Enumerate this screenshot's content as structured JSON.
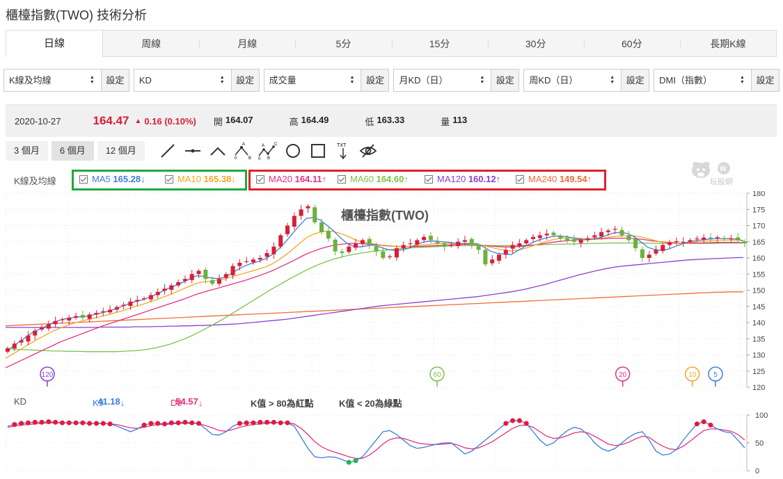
{
  "page": {
    "title": "櫃檯指數(TWO) 技術分析"
  },
  "tabs": [
    {
      "label": "日線",
      "active": true
    },
    {
      "label": "周線"
    },
    {
      "label": "月線"
    },
    {
      "label": "5分"
    },
    {
      "label": "15分"
    },
    {
      "label": "30分"
    },
    {
      "label": "60分"
    },
    {
      "label": "長期K線"
    }
  ],
  "selectors": [
    {
      "value": "K線及均線",
      "button": "設定"
    },
    {
      "value": "KD",
      "button": "設定"
    },
    {
      "value": "成交量",
      "button": "設定"
    },
    {
      "value": "月KD（日）",
      "button": "設定"
    },
    {
      "value": "周KD（日）",
      "button": "設定"
    },
    {
      "value": "DMI（指數）",
      "button": "設定"
    }
  ],
  "quote": {
    "date": "2020-10-27",
    "price": "164.47",
    "change": "0.16 (0.10%)",
    "open_label": "開",
    "open": "164.07",
    "high_label": "高",
    "high": "164.49",
    "low_label": "低",
    "low": "163.33",
    "volume_label": "量",
    "volume": "113",
    "up_color": "#d81e36"
  },
  "ranges": [
    {
      "label": "3 個月"
    },
    {
      "label": "6 個月",
      "active": true
    },
    {
      "label": "12 個月"
    }
  ],
  "drawing_tools": [
    "line-tool-icon",
    "horizontal-line-icon",
    "angle-line-icon",
    "abc-pattern-icon",
    "abcd-pattern-icon",
    "circle-tool-icon",
    "rectangle-tool-icon",
    "text-tool-icon",
    "hide-drawings-icon"
  ],
  "ma_legend": {
    "label": "K線及均線",
    "items": [
      {
        "name": "MA5",
        "value": "165.28",
        "dir": "↓",
        "color": "#3b7ddd"
      },
      {
        "name": "MA10",
        "value": "165.38",
        "dir": "↓",
        "color": "#f5a623"
      },
      {
        "name": "MA20",
        "value": "164.11",
        "dir": "↑",
        "color": "#e4317e"
      },
      {
        "name": "MA60",
        "value": "164.60",
        "dir": "↑",
        "color": "#7cc04b"
      },
      {
        "name": "MA120",
        "value": "160.12",
        "dir": "↑",
        "color": "#8a3fd1"
      },
      {
        "name": "MA240",
        "value": "149.54",
        "dir": "↑",
        "color": "#f06b3a"
      }
    ],
    "highlight_colors": {
      "green_box": "#1fa93d",
      "red_box": "#e0202a"
    }
  },
  "logo": {
    "text": "玩股網"
  },
  "chart_data": {
    "type": "candlestick",
    "title": "櫃檯指數(TWO)",
    "ylim": [
      120,
      180
    ],
    "yticks": [
      120,
      125,
      130,
      135,
      140,
      145,
      150,
      155,
      160,
      165,
      170,
      175,
      180
    ],
    "up_color": "#d81e36",
    "down_color": "#6cb13b",
    "closes": [
      132,
      133.5,
      134.5,
      136,
      137.5,
      138.5,
      139.5,
      140.5,
      141,
      141.5,
      142,
      141.5,
      142.5,
      143,
      143.5,
      144,
      144.8,
      145.5,
      146.5,
      147,
      147.5,
      148.5,
      149.5,
      150.5,
      151.5,
      152.5,
      153.5,
      155,
      156,
      153.5,
      152,
      153.5,
      155,
      157.5,
      158.5,
      159,
      159.5,
      160,
      161.5,
      163.5,
      167,
      170,
      173,
      175,
      176,
      171,
      168,
      166,
      162,
      161.5,
      163.5,
      164.5,
      165.5,
      164,
      162,
      160,
      160.5,
      163,
      164,
      164.5,
      165.5,
      166.5,
      165.5,
      164.5,
      163.5,
      164,
      165,
      165.5,
      164,
      162.5,
      158,
      159.5,
      161,
      162.5,
      164,
      164.5,
      165.5,
      166.5,
      167,
      167.5,
      167,
      166,
      165.5,
      165,
      165.5,
      166,
      167,
      168,
      168.5,
      169,
      167,
      165.5,
      163,
      160,
      161,
      162.5,
      164,
      164.8,
      165.2,
      165,
      165.5,
      166,
      166.3,
      166,
      166.4,
      165.8,
      166,
      165.5,
      164.5
    ],
    "ma_series": [
      {
        "name": "MA5",
        "values": [
          131,
          132.5,
          134,
          135.5,
          137,
          138,
          139,
          140,
          140.8,
          141.3,
          141.6,
          141.8,
          142,
          142.5,
          143,
          143.5,
          144.2,
          145,
          145.8,
          146.5,
          147,
          147.8,
          148.7,
          149.7,
          150.7,
          151.6,
          152.5,
          153.6,
          154.5,
          154.3,
          153.8,
          153.6,
          154,
          155.1,
          156.4,
          157.5,
          158.3,
          158.9,
          159.7,
          161,
          162.8,
          165,
          167.5,
          170,
          172.2,
          172.5,
          171.8,
          170.2,
          168.4,
          166.3,
          164.5,
          163.5,
          163.4,
          163.8,
          164,
          163.2,
          162.6,
          162.3,
          162.5,
          163,
          164,
          164.8,
          165.2,
          165.2,
          165,
          164.8,
          164.5,
          164.5,
          164.5,
          164.4,
          163.4,
          162.1,
          161.4,
          161.2,
          161,
          162.3,
          163.5,
          164.6,
          165.5,
          166.1,
          166.6,
          166.8,
          166.6,
          166.2,
          165.8,
          165.6,
          165.8,
          166.3,
          167,
          167.7,
          167.9,
          167.6,
          166.6,
          165,
          163.3,
          162.6,
          162.3,
          162.7,
          163.5,
          164.3,
          165,
          165.3,
          165.6,
          165.8,
          166,
          166,
          166,
          165.8,
          165.3
        ]
      },
      {
        "name": "MA10",
        "values": [
          129,
          130.2,
          131.4,
          132.8,
          134,
          135.2,
          136.3,
          137.4,
          138.3,
          139.1,
          139.8,
          140.4,
          140.9,
          141.4,
          141.9,
          142.4,
          143,
          143.6,
          144.3,
          145,
          145.6,
          146.3,
          147,
          147.8,
          148.6,
          149.5,
          150.4,
          151.3,
          152.2,
          152.6,
          152.8,
          153.1,
          153.5,
          154.1,
          154.7,
          155.3,
          155.9,
          156.5,
          157.2,
          158.1,
          159.4,
          160.9,
          162.6,
          164.4,
          166.2,
          167.3,
          168,
          168.3,
          168.2,
          167.6,
          166.8,
          165.8,
          165,
          164.6,
          164.3,
          164,
          163.8,
          163.6,
          163.5,
          163.6,
          163.8,
          164,
          164.2,
          164.4,
          164.5,
          164.5,
          164.5,
          164.5,
          164.4,
          164.2,
          163.8,
          163.3,
          162.8,
          162.4,
          162.2,
          162.4,
          162.9,
          163.6,
          164.3,
          165,
          165.6,
          166,
          166.2,
          166.2,
          166.1,
          166,
          166,
          166.1,
          166.3,
          166.6,
          166.8,
          166.9,
          166.8,
          166.5,
          166,
          165.4,
          164.9,
          164.6,
          164.5,
          164.6,
          164.8,
          164.9,
          165.1,
          165.3,
          165.4,
          165.5,
          165.5,
          165.5,
          165.4
        ]
      },
      {
        "name": "MA20",
        "values": [
          126,
          127,
          128,
          129,
          130,
          131,
          132,
          133,
          134,
          134.8,
          135.6,
          136.4,
          137.2,
          138,
          138.8,
          139.5,
          140.2,
          140.9,
          141.6,
          142.3,
          143,
          143.7,
          144.4,
          145.1,
          145.8,
          146.5,
          147.2,
          148,
          148.8,
          149.4,
          150,
          150.6,
          151.2,
          151.8,
          152.4,
          153,
          153.7,
          154.4,
          155.2,
          156,
          157,
          158,
          159,
          160.1,
          161.2,
          162,
          162.8,
          163.4,
          163.9,
          164.2,
          164.4,
          164.5,
          164.4,
          164.3,
          164.1,
          163.9,
          163.7,
          163.6,
          163.5,
          163.5,
          163.5,
          163.6,
          163.7,
          163.8,
          163.9,
          164,
          164.1,
          164.2,
          164.2,
          164.1,
          163.9,
          163.7,
          163.5,
          163.4,
          163.4,
          163.5,
          163.7,
          163.9,
          164.2,
          164.5,
          164.8,
          165.1,
          165.3,
          165.5,
          165.6,
          165.7,
          165.8,
          165.9,
          166,
          166.1,
          166.1,
          166.1,
          166,
          165.8,
          165.5,
          165.2,
          165,
          164.8,
          164.7,
          164.6,
          164.6,
          164.6,
          164.6,
          164.7,
          164.8,
          164.8,
          164.8,
          164.8,
          164.7
        ]
      },
      {
        "name": "MA60",
        "values": [
          132,
          131.8,
          131.7,
          131.6,
          131.5,
          131.4,
          131.3,
          131.2,
          131.2,
          131.1,
          131.1,
          131.1,
          131,
          131,
          131,
          131,
          131,
          131.1,
          131.2,
          131.3,
          131.5,
          131.8,
          132.2,
          132.7,
          133.3,
          134,
          134.8,
          135.7,
          136.7,
          137.8,
          138.9,
          140.1,
          141.3,
          142.6,
          143.9,
          145.2,
          146.5,
          147.8,
          149.1,
          150.4,
          151.6,
          152.8,
          154,
          155.1,
          156.2,
          157.2,
          158.1,
          158.9,
          159.6,
          160.2,
          160.7,
          161.1,
          161.5,
          161.8,
          162.1,
          162.3,
          162.5,
          162.7,
          162.9,
          163.1,
          163.2,
          163.3,
          163.4,
          163.5,
          163.6,
          163.7,
          163.8,
          163.8,
          163.8,
          163.8,
          163.8,
          163.8,
          163.8,
          163.8,
          163.8,
          163.9,
          163.9,
          164,
          164,
          164.1,
          164.2,
          164.2,
          164.3,
          164.3,
          164.4,
          164.4,
          164.5,
          164.5,
          164.6,
          164.6,
          164.6,
          164.6,
          164.6,
          164.6,
          164.6,
          164.5,
          164.5,
          164.5,
          164.5,
          164.5,
          164.5,
          164.5,
          164.5,
          164.5,
          164.5,
          164.6,
          164.6,
          164.6,
          164.6
        ]
      },
      {
        "name": "MA120",
        "values": [
          138.5,
          138.5,
          138.5,
          138.5,
          138.5,
          138.5,
          138.5,
          138.5,
          138.5,
          138.5,
          138.5,
          138.5,
          138.5,
          138.5,
          138.6,
          138.6,
          138.6,
          138.6,
          138.6,
          138.7,
          138.7,
          138.7,
          138.8,
          138.8,
          138.9,
          138.9,
          139,
          139,
          139.1,
          139.1,
          139.2,
          139.3,
          139.4,
          139.5,
          139.6,
          139.8,
          140,
          140.2,
          140.4,
          140.6,
          140.8,
          141,
          141.3,
          141.6,
          141.9,
          142.2,
          142.5,
          142.8,
          143.1,
          143.4,
          143.7,
          144,
          144.3,
          144.6,
          144.9,
          145.2,
          145.4,
          145.6,
          145.8,
          146,
          146.2,
          146.4,
          146.6,
          146.8,
          147,
          147.2,
          147.4,
          147.6,
          147.8,
          148,
          148.3,
          148.6,
          148.9,
          149.2,
          149.5,
          149.9,
          150.3,
          150.8,
          151.3,
          151.8,
          152.4,
          153,
          153.6,
          154.2,
          154.8,
          155.3,
          155.8,
          156.3,
          156.7,
          157.1,
          157.4,
          157.6,
          157.8,
          158,
          158.2,
          158.4,
          158.6,
          158.8,
          159,
          159.2,
          159.4,
          159.5,
          159.6,
          159.7,
          159.8,
          159.9,
          160,
          160.1,
          160.1
        ]
      },
      {
        "name": "MA240",
        "values": [
          139,
          139.1,
          139.2,
          139.3,
          139.4,
          139.5,
          139.6,
          139.7,
          139.8,
          139.9,
          140,
          140.1,
          140.2,
          140.3,
          140.4,
          140.5,
          140.6,
          140.7,
          140.8,
          140.9,
          141,
          141.1,
          141.2,
          141.3,
          141.4,
          141.5,
          141.6,
          141.7,
          141.8,
          141.9,
          142,
          142.1,
          142.2,
          142.3,
          142.4,
          142.5,
          142.6,
          142.7,
          142.8,
          142.9,
          143,
          143.1,
          143.2,
          143.3,
          143.4,
          143.5,
          143.6,
          143.7,
          143.8,
          143.9,
          144,
          144.1,
          144.2,
          144.3,
          144.4,
          144.5,
          144.6,
          144.7,
          144.8,
          144.9,
          145,
          145.1,
          145.2,
          145.3,
          145.4,
          145.5,
          145.6,
          145.7,
          145.8,
          145.9,
          146,
          146.1,
          146.2,
          146.3,
          146.4,
          146.5,
          146.6,
          146.7,
          146.8,
          146.9,
          147,
          147.1,
          147.2,
          147.3,
          147.4,
          147.5,
          147.6,
          147.7,
          147.8,
          147.9,
          148,
          148.1,
          148.2,
          148.3,
          148.4,
          148.5,
          148.6,
          148.7,
          148.8,
          148.9,
          149,
          149.1,
          149.2,
          149.3,
          149.4,
          149.4,
          149.5,
          149.5,
          149.5
        ]
      }
    ],
    "ma_markers": [
      {
        "label": "120",
        "index": 9,
        "color": "#8a3fd1"
      },
      {
        "label": "60",
        "index": 93,
        "color": "#7cc04b"
      },
      {
        "label": "20",
        "index": 133,
        "color": "#e4317e"
      },
      {
        "label": "10",
        "index": 148,
        "color": "#f5a623"
      },
      {
        "label": "5",
        "index": 153,
        "color": "#3b7ddd"
      }
    ]
  },
  "kd_legend": {
    "label": "KD",
    "k_label": "K9",
    "k_value": "41.18",
    "k_dir": "↓",
    "d_label": "D9",
    "d_value": "54.57",
    "d_dir": "↓",
    "note1": "K值 > 80為紅點",
    "note2": "K值 < 20為綠點"
  },
  "kd_data": {
    "type": "line",
    "ylim": [
      0,
      100
    ],
    "yticks": [
      0,
      50,
      100
    ],
    "k_color": "#3b7ddd",
    "d_color": "#e4317e",
    "k": [
      80,
      83,
      85,
      86,
      87,
      87,
      88,
      87,
      86,
      86,
      86,
      86,
      85,
      85,
      85,
      84,
      80,
      75,
      70,
      75,
      82,
      85,
      85,
      84,
      86,
      86,
      87,
      86,
      85,
      75,
      65,
      64,
      70,
      80,
      85,
      86,
      86,
      87,
      87,
      87,
      86,
      86,
      80,
      60,
      40,
      25,
      23,
      25,
      24,
      20,
      15,
      18,
      25,
      40,
      55,
      70,
      72,
      65,
      55,
      45,
      40,
      42,
      45,
      48,
      50,
      50,
      40,
      30,
      35,
      45,
      55,
      65,
      75,
      85,
      90,
      90,
      85,
      70,
      55,
      45,
      50,
      62,
      72,
      78,
      75,
      65,
      50,
      40,
      35,
      40,
      50,
      60,
      67,
      70,
      55,
      35,
      28,
      30,
      38,
      55,
      70,
      84,
      88,
      82,
      75,
      70,
      68,
      55,
      41
    ],
    "d": [
      78,
      80,
      82,
      83,
      84,
      85,
      86,
      86,
      86,
      86,
      86,
      86,
      85,
      85,
      85,
      84,
      83,
      80,
      77,
      76,
      78,
      81,
      83,
      83,
      84,
      85,
      85,
      85,
      85,
      81,
      77,
      72,
      71,
      74,
      78,
      81,
      83,
      84,
      85,
      86,
      86,
      86,
      84,
      76,
      65,
      52,
      43,
      37,
      33,
      29,
      25,
      22,
      22,
      28,
      37,
      48,
      56,
      59,
      58,
      54,
      50,
      48,
      47,
      47,
      48,
      49,
      46,
      41,
      39,
      41,
      46,
      52,
      60,
      68,
      76,
      81,
      82,
      78,
      70,
      62,
      58,
      59,
      63,
      68,
      70,
      68,
      62,
      55,
      48,
      45,
      47,
      51,
      57,
      62,
      60,
      51,
      44,
      39,
      38,
      44,
      53,
      63,
      72,
      75,
      75,
      73,
      71,
      65,
      55
    ]
  }
}
